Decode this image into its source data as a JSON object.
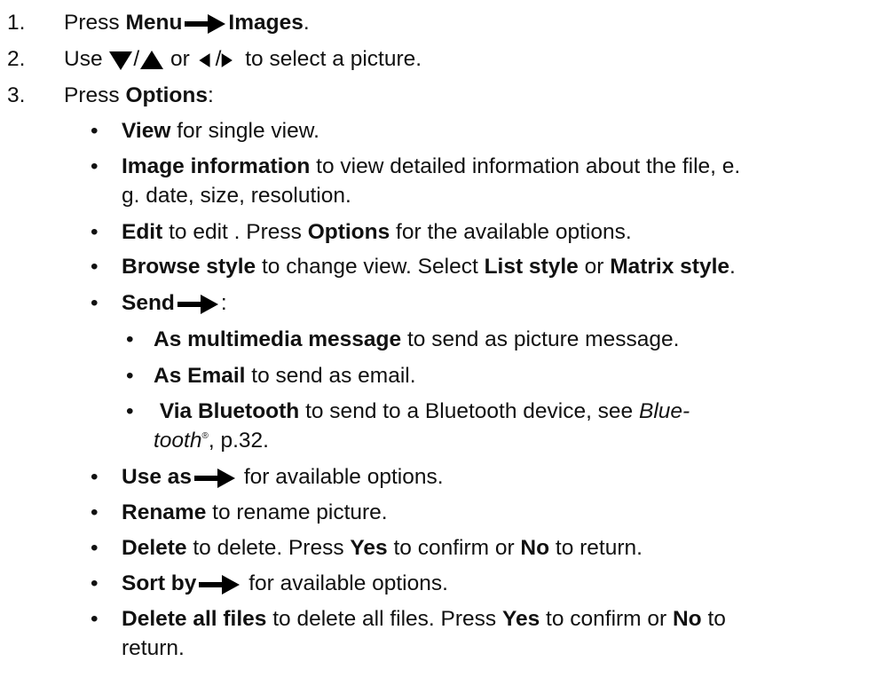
{
  "steps": [
    {
      "number": "1.",
      "pre": "Press ",
      "b1": "Menu",
      "b2": "Images",
      "post": ".",
      "arrow_icon": "right-arrow-icon"
    },
    {
      "number": "2.",
      "pre": "Use ",
      "sep1": "/",
      "mid": " or ",
      "sep2": "/",
      "post": " to select a picture.",
      "icons": [
        "down-triangle-icon",
        "up-triangle-icon",
        "left-triangle-icon",
        "right-triangle-icon"
      ]
    },
    {
      "number": "3.",
      "pre": "Press ",
      "b": "Options",
      "post": ":"
    }
  ],
  "bullet_char": "•",
  "options": {
    "view": {
      "b": "View",
      "t": " for single view."
    },
    "image_info": {
      "b": "Image information",
      "t1": " to view detailed information about the file, e.",
      "t2": "g. date, size, resolution."
    },
    "edit": {
      "b": "Edit",
      "t1": " to edit . Press ",
      "b2": "Options",
      "t2": " for the available options."
    },
    "browse": {
      "b": "Browse style",
      "t1": " to change view. Select ",
      "b2": "List style",
      "t2": " or ",
      "b3": "Matrix style",
      "t3": "."
    },
    "send": {
      "b": "Send",
      "t": ":",
      "arrow_icon": "right-arrow-icon"
    },
    "send_mms": {
      "b": "As multimedia message",
      "t": " to send as picture message."
    },
    "send_email": {
      "b": "As Email",
      "t": " to send as email."
    },
    "send_bt": {
      "pre": " ",
      "b": "Via Bluetooth",
      "t": " to send to a Bluetooth device, see ",
      "i1": "Blue-",
      "i2": "tooth",
      "sup": "®",
      "t2": ", p.32."
    },
    "use_as": {
      "b": "Use as",
      "t": " for available options.",
      "arrow_icon": "right-arrow-icon"
    },
    "rename": {
      "b": "Rename",
      "t": " to rename picture."
    },
    "delete": {
      "b": "Delete",
      "t1": " to delete. Press ",
      "b2": "Yes",
      "t2": " to confirm or ",
      "b3": "No",
      "t3": " to return."
    },
    "sort_by": {
      "b": "Sort by",
      "t": " for available options.",
      "arrow_icon": "right-arrow-icon"
    },
    "delete_all": {
      "b": "Delete all files",
      "t1": " to delete all files. Press ",
      "b2": "Yes",
      "t2": " to confirm or ",
      "b3": "No",
      "t3": " to",
      "t4": "return."
    }
  }
}
